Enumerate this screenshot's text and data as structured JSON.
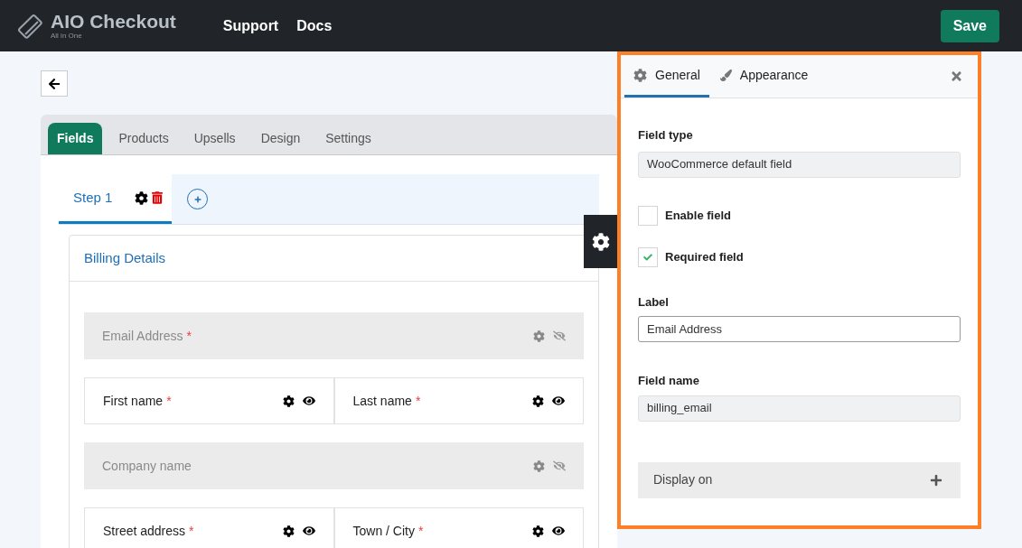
{
  "header": {
    "logo_title": "AIO Checkout",
    "logo_subtitle": "All in One",
    "nav": [
      "Support",
      "Docs"
    ],
    "save": "Save"
  },
  "tabs": [
    {
      "label": "Fields",
      "selected": true
    },
    {
      "label": "Products",
      "selected": false
    },
    {
      "label": "Upsells",
      "selected": false
    },
    {
      "label": "Design",
      "selected": false
    },
    {
      "label": "Settings",
      "selected": false
    }
  ],
  "steps": [
    {
      "label": "Step 1",
      "selected": true
    }
  ],
  "section": {
    "title": "Billing Details"
  },
  "rows": [
    {
      "fields": [
        {
          "label": "Email Address",
          "required_mark": "*",
          "hidden": true
        }
      ]
    },
    {
      "fields": [
        {
          "label": "First name",
          "required_mark": "*",
          "hidden": false
        },
        {
          "label": "Last name",
          "required_mark": "*",
          "hidden": false
        }
      ]
    },
    {
      "fields": [
        {
          "label": "Company name",
          "hidden": true
        }
      ]
    },
    {
      "fields": [
        {
          "label": "Street address",
          "required_mark": "*",
          "hidden": false
        },
        {
          "label": "Town / City",
          "required_mark": "*",
          "hidden": false
        }
      ]
    }
  ],
  "panel": {
    "tabs": [
      {
        "label": "General",
        "kind": "gear",
        "selected": true
      },
      {
        "label": "Appearance",
        "kind": "brush",
        "selected": false
      }
    ],
    "field_type_label": "Field type",
    "field_type_value": "WooCommerce default field",
    "checks": [
      {
        "label": "Enable field",
        "checked": false
      },
      {
        "label": "Required field",
        "checked": true
      }
    ],
    "label_label": "Label",
    "label_value": "Email Address",
    "name_label": "Field name",
    "name_value": "billing_email",
    "display_on": "Display on"
  }
}
